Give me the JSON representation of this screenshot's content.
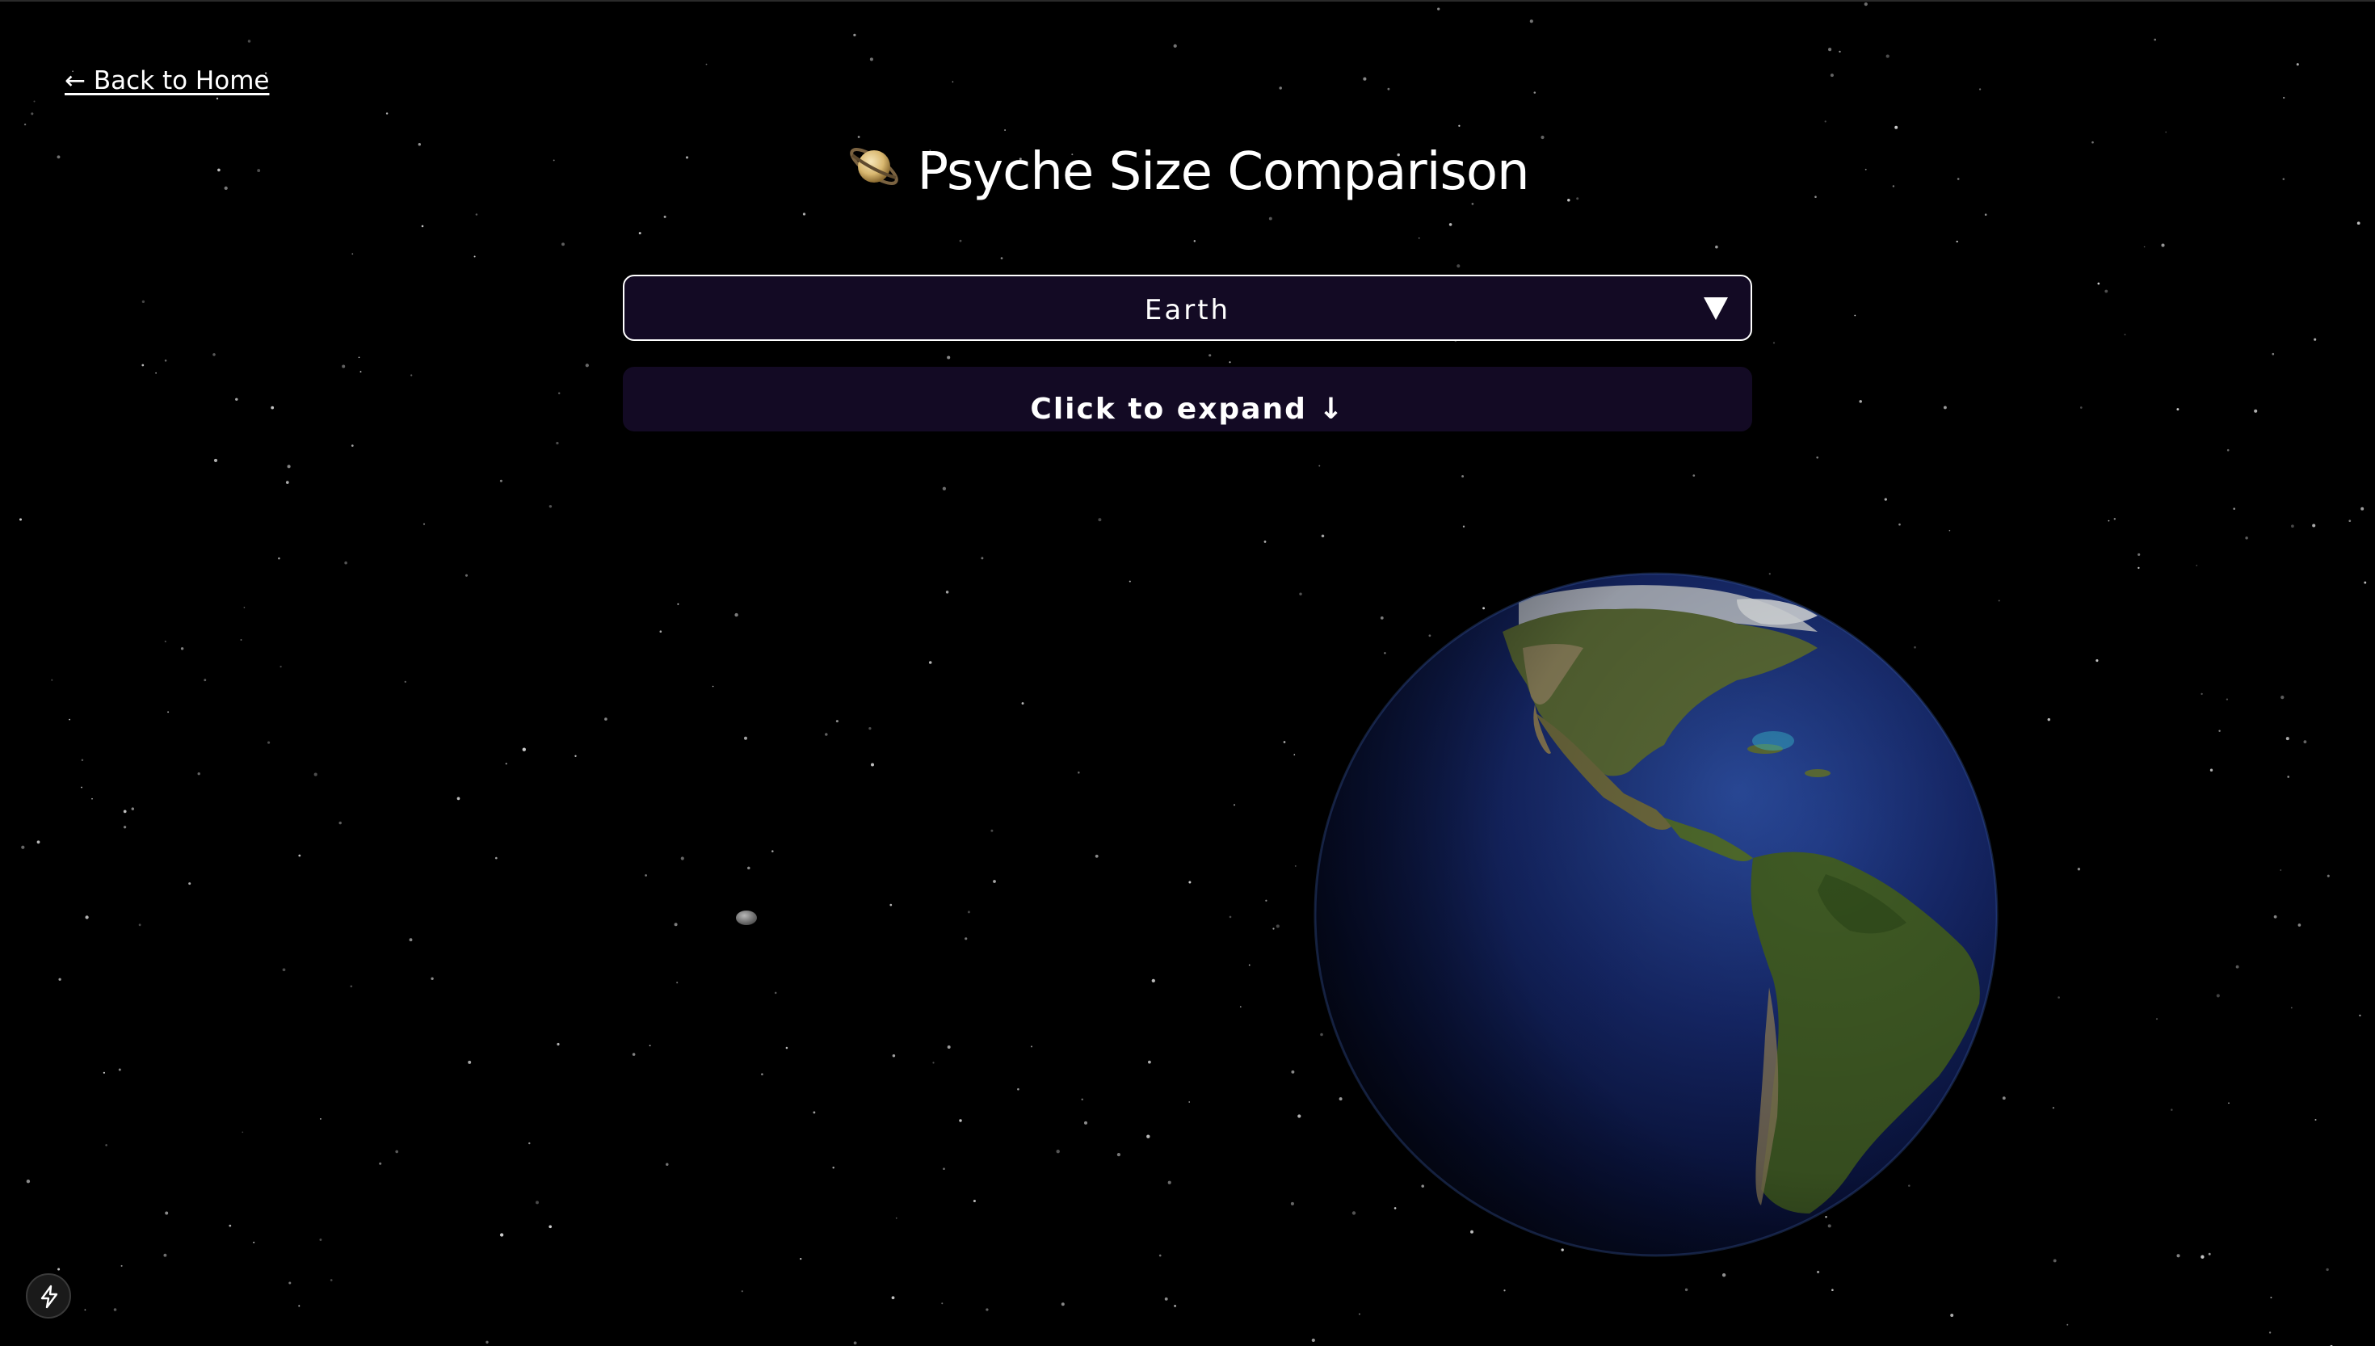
{
  "nav": {
    "back_label": "← Back to Home"
  },
  "header": {
    "title": "Psyche Size Comparison",
    "title_icon": "ringed-planet-icon"
  },
  "selector": {
    "selected_value": "Earth",
    "arrow_icon": "triangle-down-icon"
  },
  "expand": {
    "label": "Click to expand ↓"
  },
  "scene": {
    "bodies": [
      "psyche-asteroid",
      "earth-globe"
    ]
  },
  "footer": {
    "dev_icon": "lightning-bolt-icon"
  },
  "colors": {
    "background": "#000000",
    "panel": "#130a24",
    "text": "#ffffff",
    "ocean": "#1a2f7a",
    "land": "#4a6a2a"
  }
}
